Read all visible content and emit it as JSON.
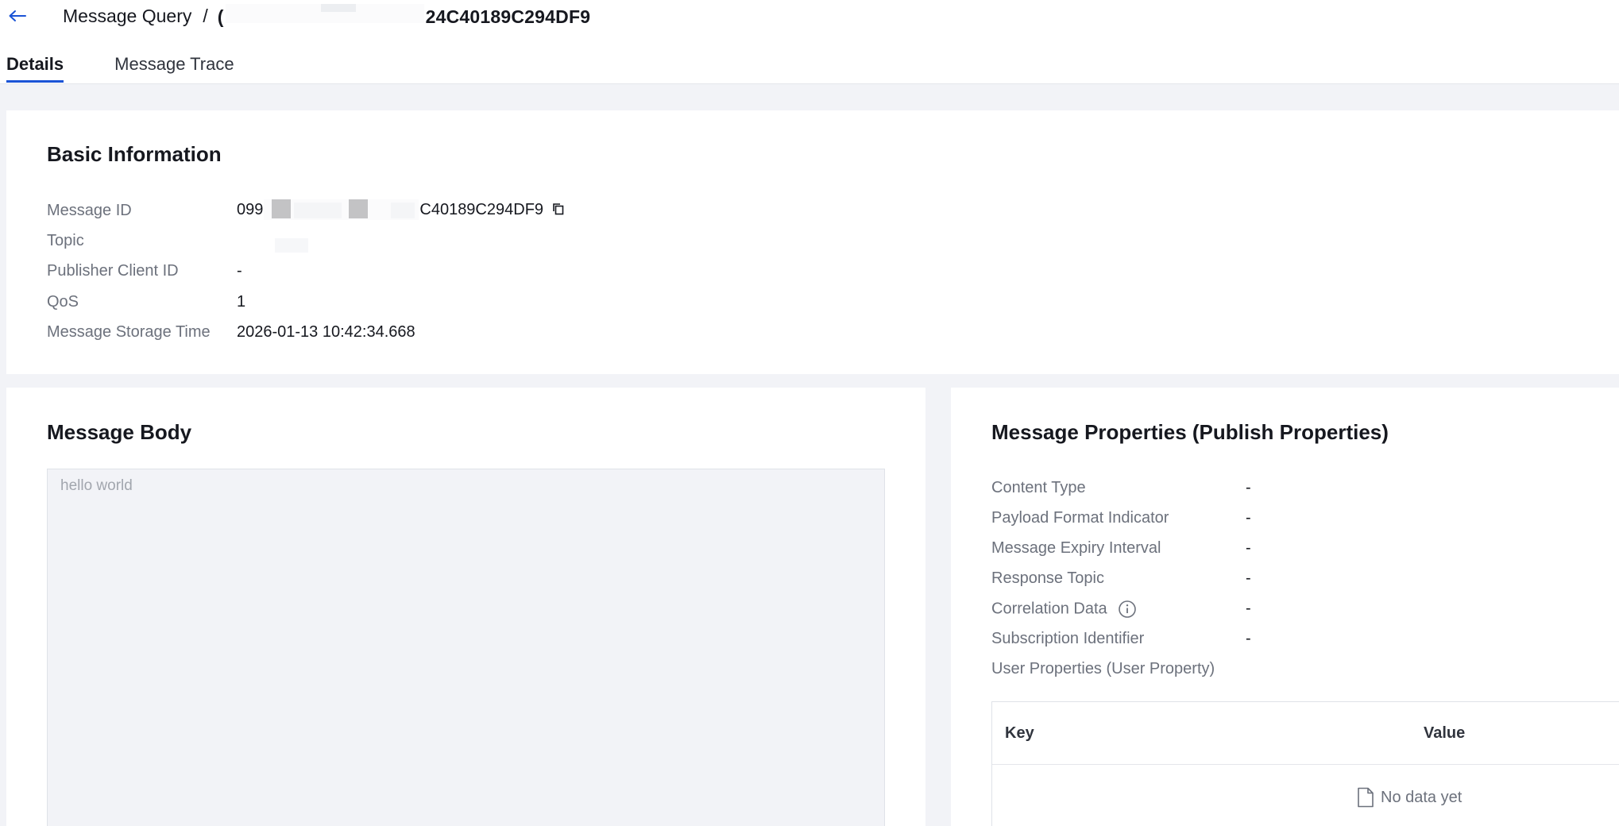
{
  "header": {
    "back_icon": "arrow-left-icon",
    "breadcrumb_root": "Message Query",
    "breadcrumb_sep": "/",
    "breadcrumb_current_start": "(",
    "breadcrumb_current_end": "24C40189C294DF9"
  },
  "tabs": [
    {
      "label": "Details",
      "active": true
    },
    {
      "label": "Message Trace",
      "active": false
    }
  ],
  "basic": {
    "title": "Basic Information",
    "rows": [
      {
        "label": "Message ID",
        "value_start": "099",
        "value_end": "C40189C294DF9"
      },
      {
        "label": "Topic",
        "value": ""
      },
      {
        "label": "Publisher Client ID",
        "value": "-"
      },
      {
        "label": "QoS",
        "value": "1"
      },
      {
        "label": "Message Storage Time",
        "value": "2026-01-13 10:42:34.668"
      }
    ]
  },
  "body": {
    "title": "Message Body",
    "content": "hello world"
  },
  "props": {
    "title": "Message Properties (Publish Properties)",
    "rows": [
      {
        "label": "Content Type",
        "value": "-"
      },
      {
        "label": "Payload Format Indicator",
        "value": "-"
      },
      {
        "label": "Message Expiry Interval",
        "value": "-"
      },
      {
        "label": "Response Topic",
        "value": "-"
      },
      {
        "label": "Correlation Data",
        "value": "-"
      },
      {
        "label": "Subscription Identifier",
        "value": "-"
      }
    ],
    "user_props_label": "User Properties (User Property)",
    "table": {
      "col_key": "Key",
      "col_value": "Value",
      "empty_text": "No data yet"
    }
  },
  "colors": {
    "accent": "#1b54d6",
    "page_bg": "#f2f3f7",
    "label": "#6c717c"
  }
}
